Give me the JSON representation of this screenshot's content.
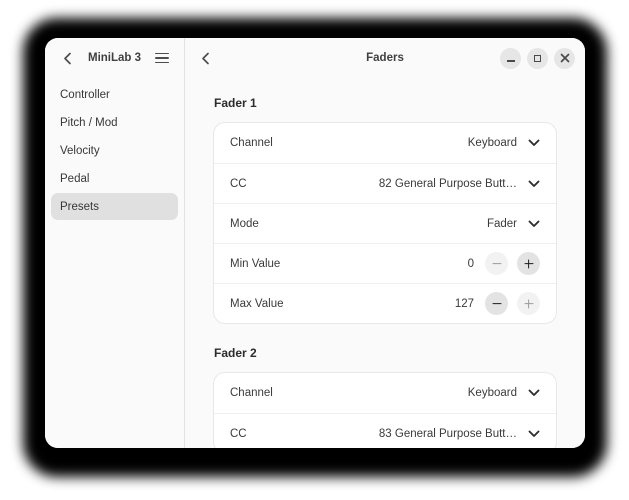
{
  "window": {
    "sidebar": {
      "title": "MiniLab 3",
      "back_icon": "chevron-left",
      "menu_icon": "hamburger-menu",
      "items": [
        {
          "label": "Controller",
          "selected": false
        },
        {
          "label": "Pitch / Mod",
          "selected": false
        },
        {
          "label": "Velocity",
          "selected": false
        },
        {
          "label": "Pedal",
          "selected": false
        },
        {
          "label": "Presets",
          "selected": true
        }
      ]
    },
    "header": {
      "back_icon": "chevron-left",
      "title": "Faders",
      "window_controls": [
        {
          "name": "minimize",
          "icon": "minimize-icon"
        },
        {
          "name": "maximize",
          "icon": "maximize-icon"
        },
        {
          "name": "close",
          "icon": "close-icon"
        }
      ]
    },
    "content": {
      "sections": [
        {
          "heading": "Fader 1",
          "rows": [
            {
              "type": "dropdown",
              "label": "Channel",
              "value": "Keyboard",
              "icon": "chevron-down"
            },
            {
              "type": "dropdown",
              "label": "CC",
              "value": "82 General Purpose Butt…",
              "icon": "chevron-down"
            },
            {
              "type": "dropdown",
              "label": "Mode",
              "value": "Fader",
              "icon": "chevron-down"
            },
            {
              "type": "stepper",
              "label": "Min Value",
              "value": "0",
              "icons": [
                "minus",
                "plus"
              ],
              "minus_enabled": false,
              "plus_enabled": true
            },
            {
              "type": "stepper",
              "label": "Max Value",
              "value": "127",
              "icons": [
                "minus",
                "plus"
              ],
              "minus_enabled": true,
              "plus_enabled": false
            }
          ]
        },
        {
          "heading": "Fader 2",
          "rows": [
            {
              "type": "dropdown",
              "label": "Channel",
              "value": "Keyboard",
              "icon": "chevron-down"
            },
            {
              "type": "dropdown",
              "label": "CC",
              "value": "83 General Purpose Butt…",
              "icon": "chevron-down"
            }
          ]
        }
      ]
    },
    "colors": {
      "window_bg": "#fafafa",
      "card_bg": "#ffffff",
      "selected_item_bg": "#e0e0e0",
      "divider": "#e2e2e2",
      "shadow": "#000000",
      "text": "#3a3a3a"
    }
  }
}
